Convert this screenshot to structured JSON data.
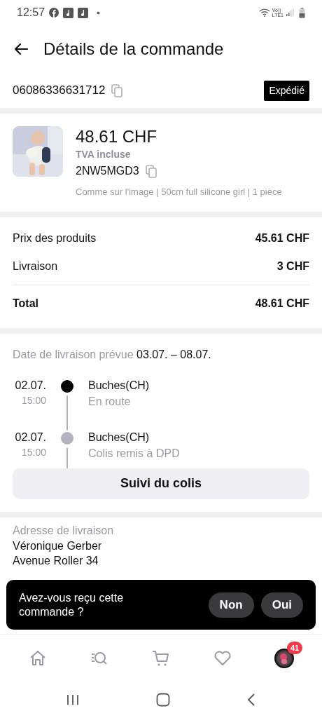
{
  "status_bar": {
    "time": "12:57",
    "network_labels": [
      "Vo))",
      "LTE1"
    ]
  },
  "header": {
    "title": "Détails de la commande"
  },
  "order": {
    "number": "06086336631712",
    "status": "Expédié"
  },
  "product": {
    "kind": "picture",
    "price": "48.61 CHF",
    "tax_note": "TVA incluse",
    "code": "2NW5MGD3",
    "variant": "Comme sur l'image | 50cm full silicone girl | 1 pièce"
  },
  "costs": [
    {
      "label": "Prix des produits",
      "value": "45.61 CHF",
      "kind": "line"
    },
    {
      "label": "Livraison",
      "value": "3 CHF",
      "kind": "line"
    },
    {
      "label": "Total",
      "value": "48.61 CHF",
      "kind": "total"
    }
  ],
  "delivery": {
    "label": "Date de livraison prévue",
    "dates": "03.07. – 08.07."
  },
  "tracking": [
    {
      "date": "02.07.",
      "time": "15:00",
      "place": "Buches(CH)",
      "status": "En route",
      "active": true
    },
    {
      "date": "02.07.",
      "time": "15:00",
      "place": "Buches(CH)",
      "status": "Colis remis à DPD",
      "active": false
    }
  ],
  "tracking_button": "Suivi du colis",
  "address": {
    "label": "Adresse de livraison",
    "lines": [
      "Véronique Gerber",
      "Avenue Roller 34"
    ]
  },
  "toast": {
    "question": "Avez-vous reçu cette commande ?",
    "buttons": [
      "Non",
      "Oui"
    ]
  },
  "bottom_nav": [
    {
      "kind": "home",
      "selected": false
    },
    {
      "kind": "search",
      "selected": false
    },
    {
      "kind": "cart",
      "selected": false
    },
    {
      "kind": "wishlist",
      "selected": false
    },
    {
      "kind": "profile",
      "selected": false,
      "badge": "41"
    }
  ]
}
